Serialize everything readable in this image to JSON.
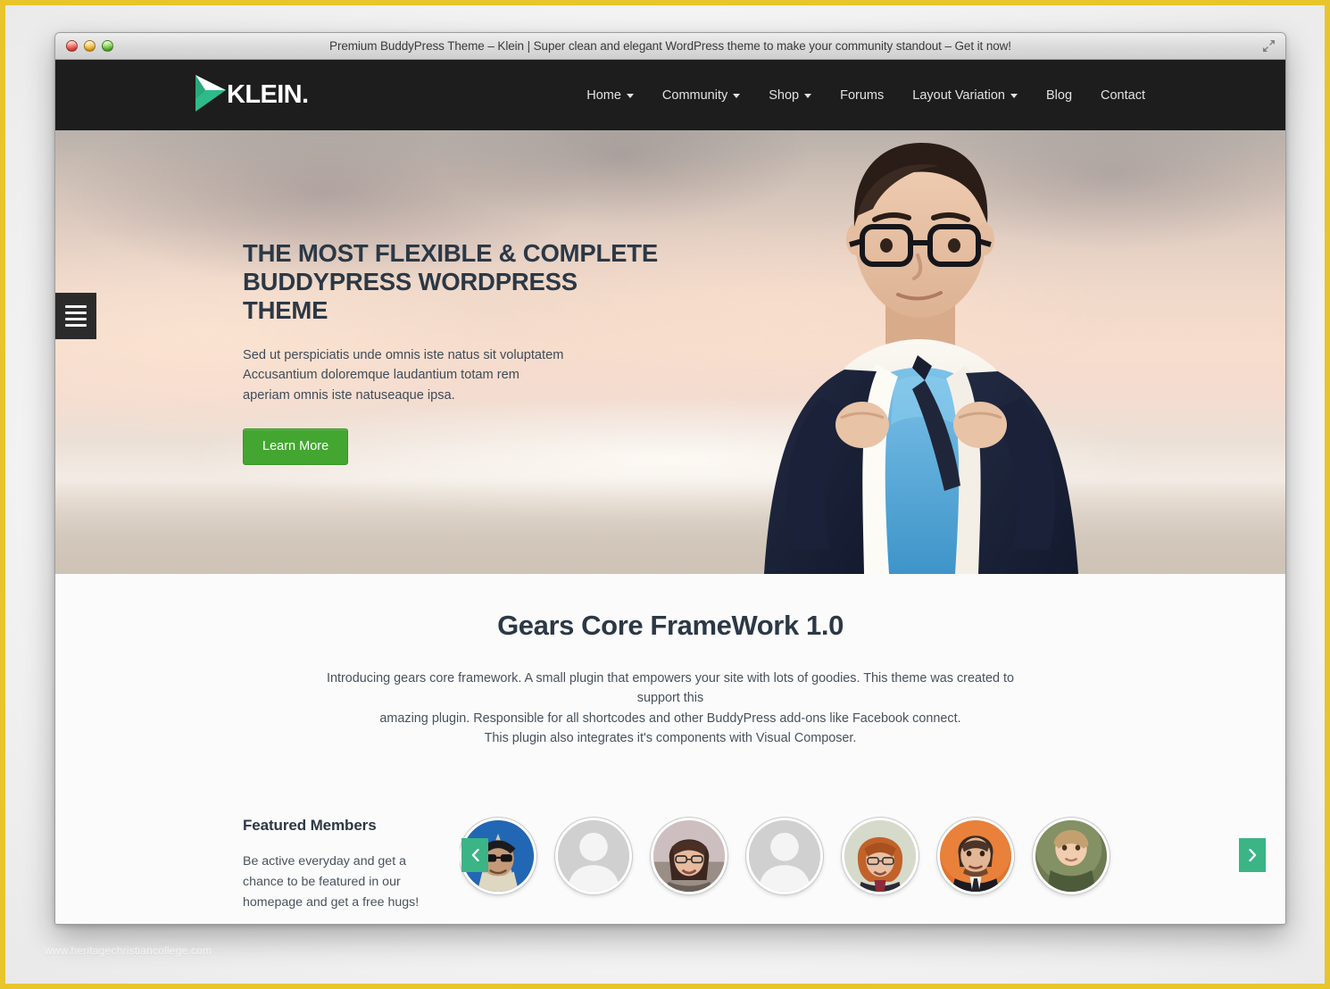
{
  "window": {
    "title": "Premium BuddyPress Theme – Klein | Super clean and elegant WordPress theme to make your community standout – Get it now!",
    "controls": {
      "close": "close",
      "minimize": "minimize",
      "maximize": "maximize"
    },
    "expand_icon": "fullscreen-icon"
  },
  "header": {
    "brand_text": "KLEIN.",
    "brand_mark": "klein-arrow-logo",
    "nav": [
      {
        "label": "Home",
        "has_dropdown": true
      },
      {
        "label": "Community",
        "has_dropdown": true
      },
      {
        "label": "Shop",
        "has_dropdown": true
      },
      {
        "label": "Forums",
        "has_dropdown": false
      },
      {
        "label": "Layout Variation",
        "has_dropdown": true
      },
      {
        "label": "Blog",
        "has_dropdown": false
      },
      {
        "label": "Contact",
        "has_dropdown": false
      }
    ]
  },
  "hero": {
    "menu_toggle_icon": "hamburger-icon",
    "title_line1": "THE MOST FLEXIBLE & COMPLETE",
    "title_line2": "BUDDYPRESS WORDPRESS THEME",
    "subtitle": "Sed ut perspiciatis unde omnis iste natus sit voluptatem Accusantium doloremque laudantium totam rem aperiam omnis iste natuseaque ipsa.",
    "cta_label": "Learn More"
  },
  "gears": {
    "title": "Gears Core FrameWork 1.0",
    "desc_line1": "Introducing gears core framework. A small plugin that empowers your site with lots of goodies. This theme was created to support this",
    "desc_line2": "amazing plugin. Responsible for all shortcodes and other BuddyPress add-ons like Facebook connect.",
    "desc_line3": "This plugin also integrates it's components with Visual Composer."
  },
  "members": {
    "heading": "Featured Members",
    "text": "Be active everyday and get a chance to be featured in our homepage and get a free hugs!",
    "prev_icon": "chevron-left-icon",
    "next_icon": "chevron-right-icon",
    "avatars": [
      {
        "type": "photo",
        "alt": "member-hooded-man-with-glasses"
      },
      {
        "type": "placeholder",
        "alt": "member-default-avatar"
      },
      {
        "type": "photo",
        "alt": "member-smiling-woman-with-glasses"
      },
      {
        "type": "placeholder",
        "alt": "member-default-avatar"
      },
      {
        "type": "photo",
        "alt": "member-red-haired-woman"
      },
      {
        "type": "photo",
        "alt": "member-man-in-suit"
      },
      {
        "type": "photo",
        "alt": "member-child"
      }
    ]
  },
  "watermark": {
    "text": "www.heritagechristiancollege.com"
  },
  "colors": {
    "header_bg": "#1d1d1d",
    "accent_green": "#43a630",
    "carousel_green": "#3bb486",
    "logo_green": "#2dbb8a",
    "heading_navy": "#2c3845",
    "frame_gold": "#e8c52a"
  }
}
